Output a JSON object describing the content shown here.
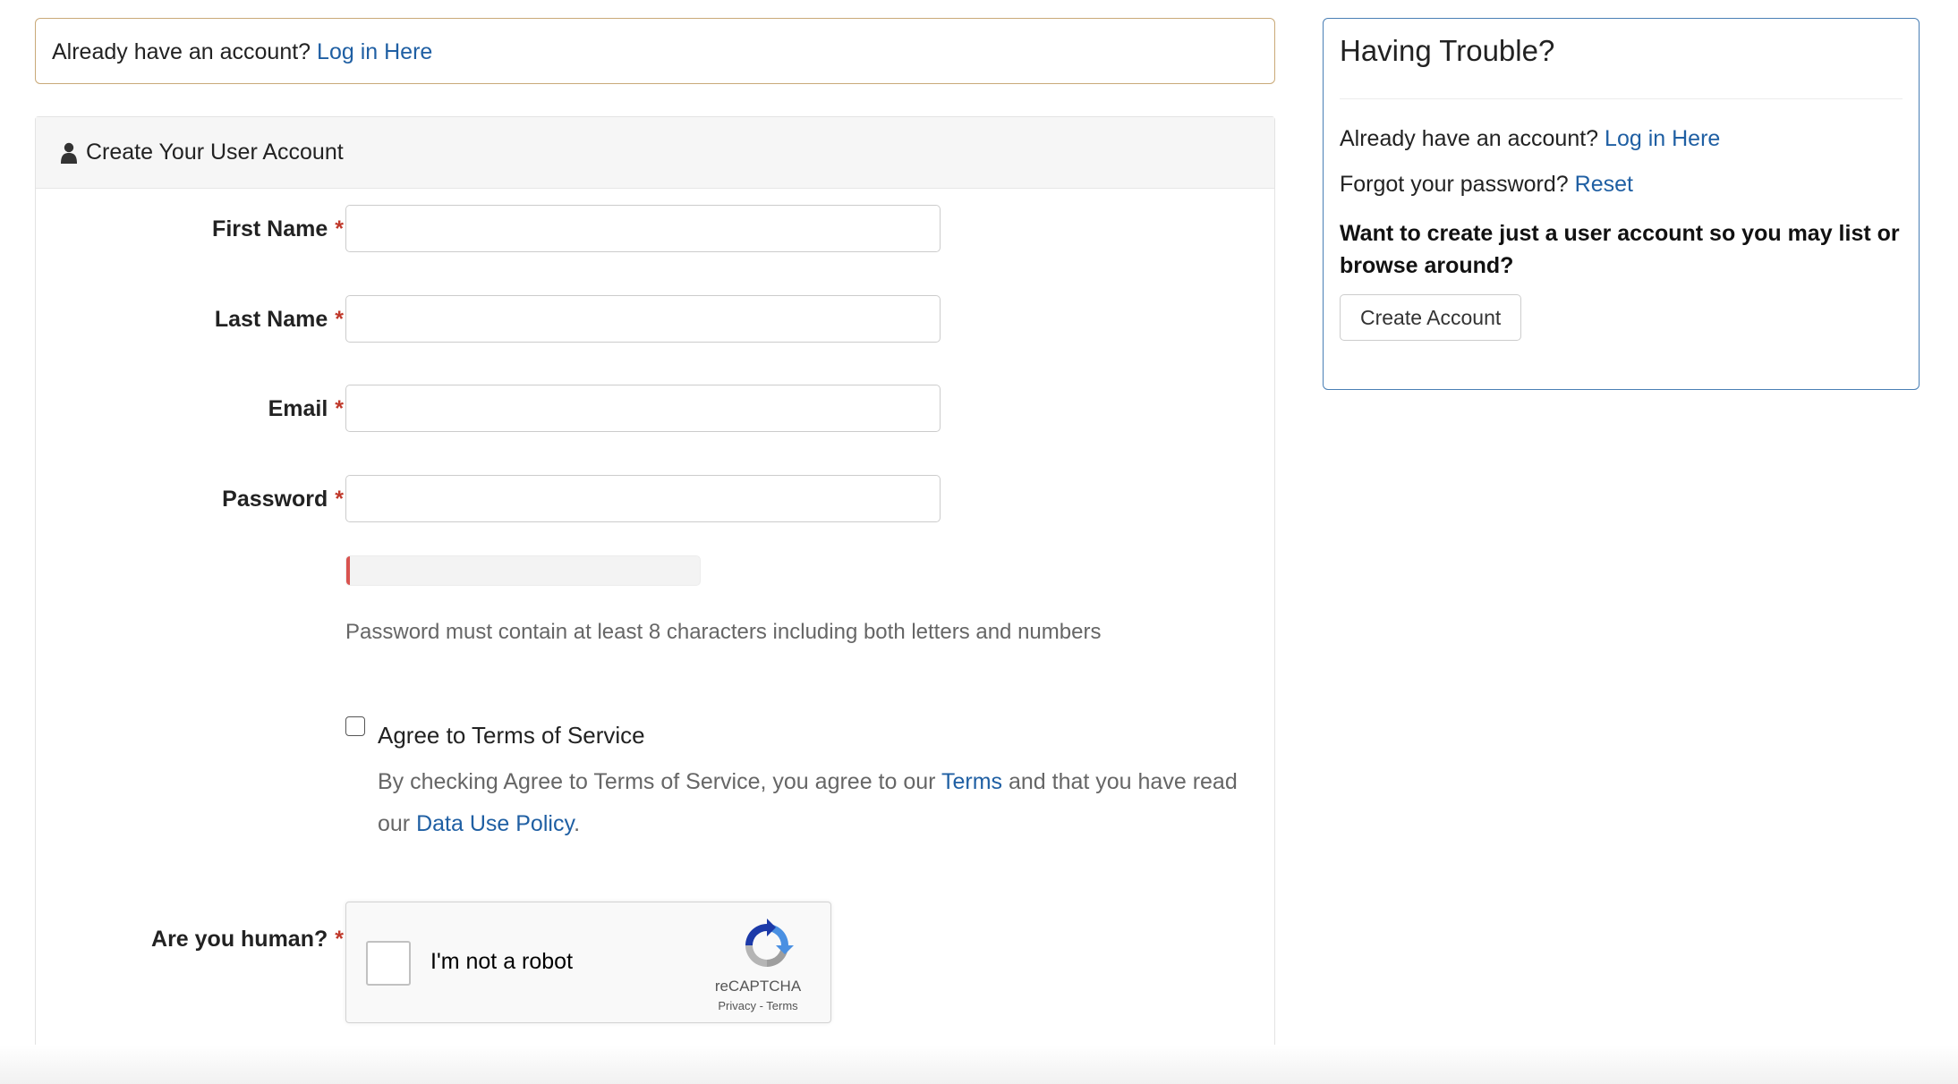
{
  "login_notice": {
    "text": "Already have an account?",
    "link": "Log in Here"
  },
  "create_panel": {
    "icon": "user-icon",
    "title": "Create Your User Account",
    "fields": {
      "first_name": {
        "label": "First Name",
        "required": "*",
        "value": ""
      },
      "last_name": {
        "label": "Last Name",
        "required": "*",
        "value": ""
      },
      "email": {
        "label": "Email",
        "required": "*",
        "value": ""
      },
      "password": {
        "label": "Password",
        "required": "*",
        "value": ""
      }
    },
    "password_strength": {
      "level_percent": 1,
      "color": "#d9534f"
    },
    "password_help": "Password must contain at least 8 characters including both letters and numbers",
    "terms": {
      "label": "Agree to Terms of Service",
      "desc_part1": "By checking Agree to Terms of Service, you agree to our ",
      "terms_link": "Terms",
      "desc_part2": " and that you have read our ",
      "policy_link": "Data Use Policy",
      "desc_part3": "."
    },
    "human": {
      "label": "Are you human?",
      "required": "*"
    },
    "recaptcha": {
      "label": "I'm not a robot",
      "brand": "reCAPTCHA",
      "privacy": "Privacy",
      "separator": " - ",
      "terms": "Terms"
    }
  },
  "trouble_panel": {
    "title": "Having Trouble?",
    "login_text": "Already have an account?",
    "login_link": "Log in Here",
    "forgot_text": "Forgot your password?",
    "reset_link": "Reset",
    "create_prompt": "Want to create just a user account so you may list or browse around?",
    "create_button": "Create Account"
  },
  "colors": {
    "link": "#1f5fa3",
    "required": "#c0392b",
    "notice_border": "#c9a978",
    "trouble_border": "#4a7fb5"
  }
}
